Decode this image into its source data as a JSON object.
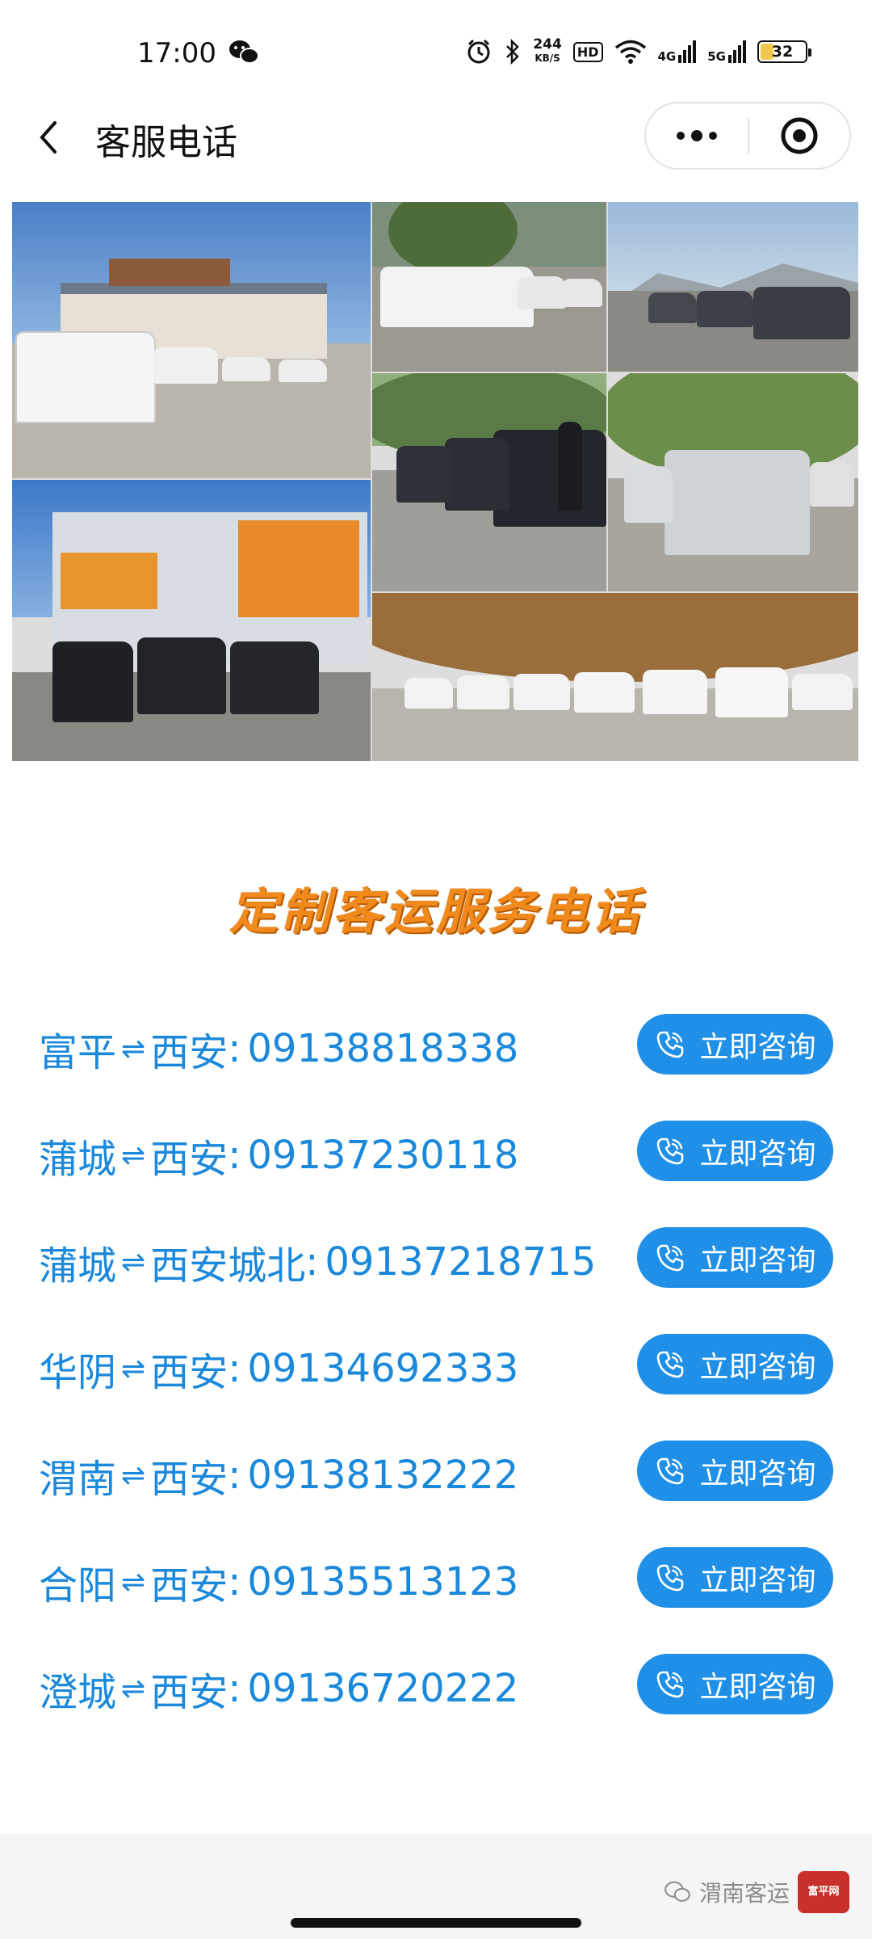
{
  "status_bar": {
    "time": "17:00",
    "speed_value": "244",
    "speed_unit": "KB/S",
    "hd_label": "HD",
    "network_1": "4G",
    "network_2": "5G",
    "battery": "32"
  },
  "nav": {
    "title": "客服电话",
    "back_icon": "chevron-left-icon",
    "more_icon": "more-dots-icon",
    "close_icon": "close-miniprogram-icon"
  },
  "banner_image": "collage of passenger vans at bus stations",
  "section_title": "定制客运服务电话",
  "routes": [
    {
      "from": "富平",
      "to": "西安",
      "phone": "09138818338",
      "button": "立即咨询"
    },
    {
      "from": "蒲城",
      "to": "西安",
      "phone": "09137230118",
      "button": "立即咨询"
    },
    {
      "from": "蒲城",
      "to": "西安城北",
      "phone": "09137218715",
      "button": "立即咨询"
    },
    {
      "from": "华阴",
      "to": "西安",
      "phone": "09134692333",
      "button": "立即咨询"
    },
    {
      "from": "渭南",
      "to": "西安",
      "phone": "09138132222",
      "button": "立即咨询"
    },
    {
      "from": "合阳",
      "to": "西安",
      "phone": "09135513123",
      "button": "立即咨询"
    },
    {
      "from": "澄城",
      "to": "西安",
      "phone": "09136720222",
      "button": "立即咨询"
    }
  ],
  "route_arrow": "⇌",
  "colors": {
    "accent": "#1f8fe8",
    "route_text": "#1a88db",
    "title_orange": "#f08a1c"
  },
  "watermark": {
    "text": "渭南客运",
    "logo_text": "富平网"
  }
}
